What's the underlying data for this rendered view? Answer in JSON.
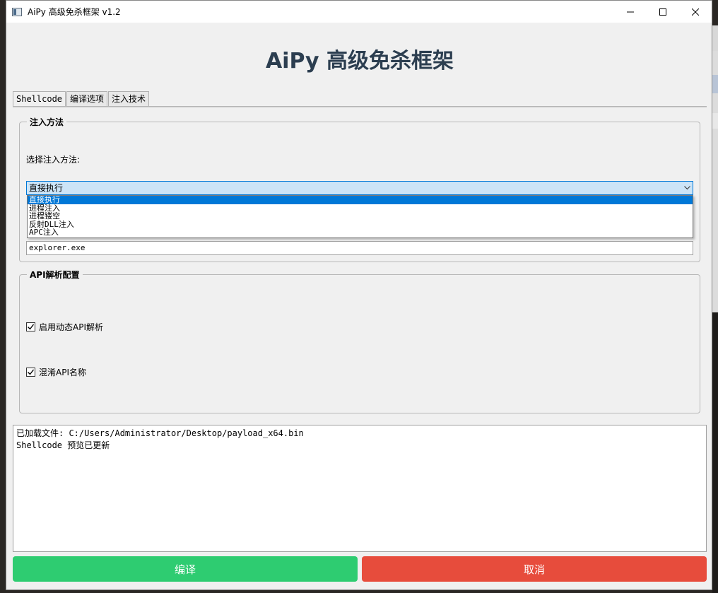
{
  "window": {
    "title": "AiPy 高级免杀框架 v1.2"
  },
  "header": {
    "title": "AiPy 高级免杀框架"
  },
  "tabs": [
    {
      "label": "Shellcode"
    },
    {
      "label": "编译选项"
    },
    {
      "label": "注入技术"
    }
  ],
  "injection": {
    "group_title": "注入方法",
    "select_label": "选择注入方法:",
    "selected_value": "直接执行",
    "options": [
      "直接执行",
      "进程注入",
      "进程镂空",
      "反射DLL注入",
      "APC注入"
    ],
    "target_process": "explorer.exe"
  },
  "api": {
    "group_title": "API解析配置",
    "dynamic_label": "启用动态API解析",
    "dynamic_checked": true,
    "obfuscate_label": "混淆API名称",
    "obfuscate_checked": true
  },
  "log": {
    "lines": [
      "已加载文件: C:/Users/Administrator/Desktop/payload_x64.bin",
      "Shellcode 预览已更新"
    ]
  },
  "buttons": {
    "compile_label": "编译",
    "cancel_label": "取消"
  },
  "colors": {
    "title": "#2c3e50",
    "compile": "#2ecc71",
    "cancel": "#e74c3c",
    "selection": "#0078d7"
  }
}
